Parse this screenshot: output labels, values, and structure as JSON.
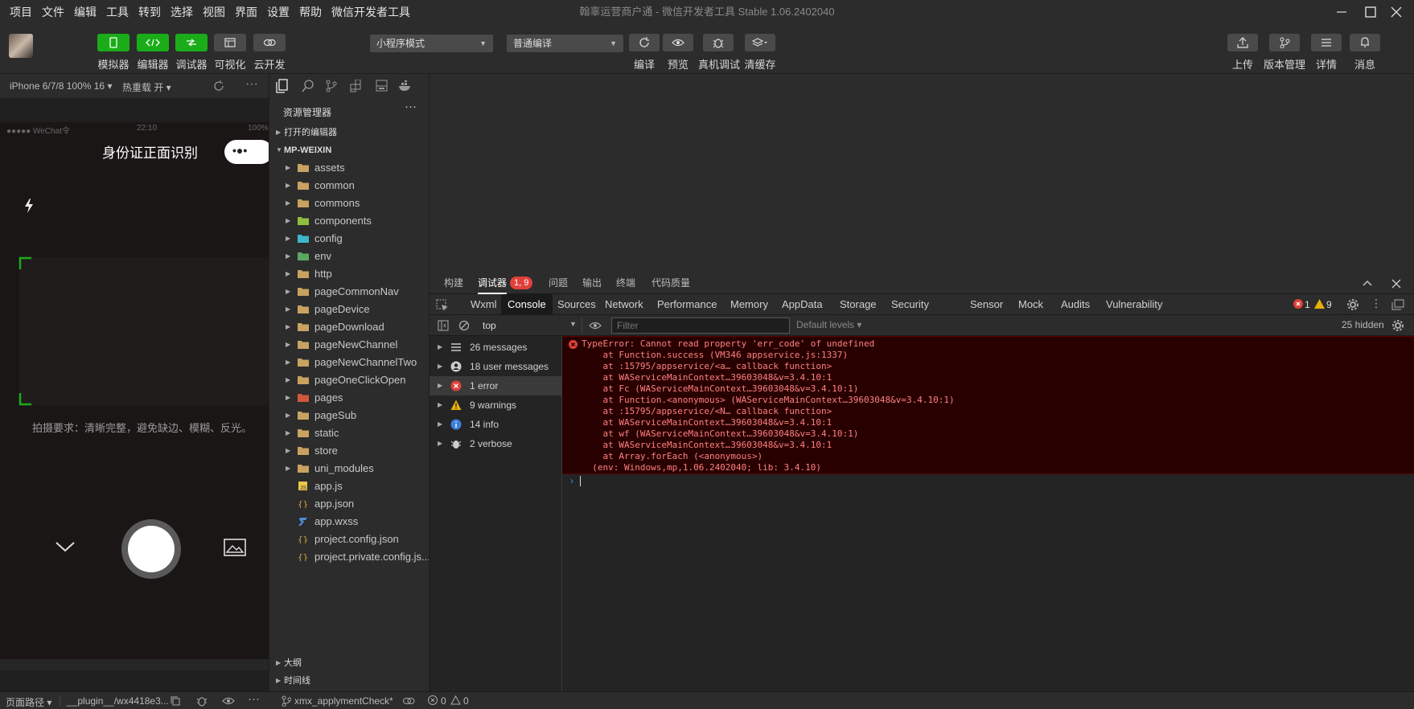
{
  "menu": [
    "项目",
    "文件",
    "编辑",
    "工具",
    "转到",
    "选择",
    "视图",
    "界面",
    "设置",
    "帮助",
    "微信开发者工具"
  ],
  "window_title": "翰辜运营商户通 - 微信开发者工具 Stable 1.06.2402040",
  "toolbar": {
    "simulator": "模拟器",
    "editor": "编辑器",
    "debugger": "调试器",
    "visual": "可视化",
    "cloud": "云开发",
    "mode_select": "小程序模式",
    "compile_select": "普通编译",
    "compile": "编译",
    "preview": "预览",
    "real_debug": "真机调试",
    "clear_cache": "清缓存",
    "upload": "上传",
    "version": "版本管理",
    "details": "详情",
    "messages": "消息"
  },
  "simulator": {
    "device": "iPhone 6/7/8 100% 16",
    "hot_reload": "热重载 开",
    "status_carrier": "●●●●● WeChat令",
    "status_time": "22:10",
    "status_battery": "100%",
    "page_title": "身份证正面识别",
    "hint": "拍摄要求：清晰完整，避免缺边、模糊、反光。"
  },
  "explorer": {
    "title": "资源管理器",
    "open_editors": "打开的编辑器",
    "project": "MP-WEIXIN",
    "items": [
      {
        "name": "assets",
        "type": "folder"
      },
      {
        "name": "common",
        "type": "folder"
      },
      {
        "name": "commons",
        "type": "folder"
      },
      {
        "name": "components",
        "type": "folder-green"
      },
      {
        "name": "config",
        "type": "folder-cyan"
      },
      {
        "name": "env",
        "type": "folder-green2"
      },
      {
        "name": "http",
        "type": "folder"
      },
      {
        "name": "pageCommonNav",
        "type": "folder"
      },
      {
        "name": "pageDevice",
        "type": "folder"
      },
      {
        "name": "pageDownload",
        "type": "folder"
      },
      {
        "name": "pageNewChannel",
        "type": "folder"
      },
      {
        "name": "pageNewChannelTwo",
        "type": "folder"
      },
      {
        "name": "pageOneClickOpen",
        "type": "folder"
      },
      {
        "name": "pages",
        "type": "folder-red"
      },
      {
        "name": "pageSub",
        "type": "folder"
      },
      {
        "name": "static",
        "type": "folder"
      },
      {
        "name": "store",
        "type": "folder"
      },
      {
        "name": "uni_modules",
        "type": "folder"
      },
      {
        "name": "app.js",
        "type": "js"
      },
      {
        "name": "app.json",
        "type": "json"
      },
      {
        "name": "app.wxss",
        "type": "css"
      },
      {
        "name": "project.config.json",
        "type": "json"
      },
      {
        "name": "project.private.config.js...",
        "type": "json"
      }
    ],
    "outline": "大纲",
    "timeline": "时间线"
  },
  "devtools": {
    "top_tabs": [
      "构建",
      "调试器",
      "问题",
      "输出",
      "终端",
      "代码质量"
    ],
    "debug_badge": "1, 9",
    "panel_tabs": [
      "Wxml",
      "Console",
      "Sources",
      "Network",
      "Performance",
      "Memory",
      "AppData",
      "Storage",
      "Security",
      "Sensor",
      "Mock",
      "Audits",
      "Vulnerability"
    ],
    "error_count": "1",
    "warning_count": "9",
    "context": "top",
    "filter_placeholder": "Filter",
    "levels": "Default levels",
    "hidden": "25 hidden",
    "sidebar": [
      {
        "label": "26 messages",
        "icon": "list"
      },
      {
        "label": "18 user messages",
        "icon": "user"
      },
      {
        "label": "1 error",
        "icon": "error"
      },
      {
        "label": "9 warnings",
        "icon": "warning"
      },
      {
        "label": "14 info",
        "icon": "info"
      },
      {
        "label": "2 verbose",
        "icon": "verbose"
      }
    ],
    "error_lines": [
      "TypeError: Cannot read property 'err_code' of undefined",
      "    at Function.success (VM346 appservice.js:1337)",
      "    at :15795/appservice/<a… callback function>",
      "    at WAServiceMainContext…39603048&v=3.4.10:1",
      "    at Fc (WAServiceMainContext…39603048&v=3.4.10:1)",
      "    at Function.<anonymous> (WAServiceMainContext…39603048&v=3.4.10:1)",
      "    at :15795/appservice/<N… callback function>",
      "    at WAServiceMainContext…39603048&v=3.4.10:1",
      "    at wf (WAServiceMainContext…39603048&v=3.4.10:1)",
      "    at WAServiceMainContext…39603048&v=3.4.10:1",
      "    at Array.forEach (<anonymous>)",
      "  (env: Windows,mp,1.06.2402040; lib: 3.4.10)"
    ]
  },
  "statusbar": {
    "page_path": "页面路径",
    "plugin_path": "__plugin__/wx4418e3...",
    "branch": "xmx_applymentCheck*",
    "errors": "0",
    "warnings": "0"
  },
  "colors": {
    "accent_green": "#1aad19",
    "error_red": "#e0403a",
    "warning_yellow": "#e5b00b",
    "error_bg": "#290000"
  }
}
